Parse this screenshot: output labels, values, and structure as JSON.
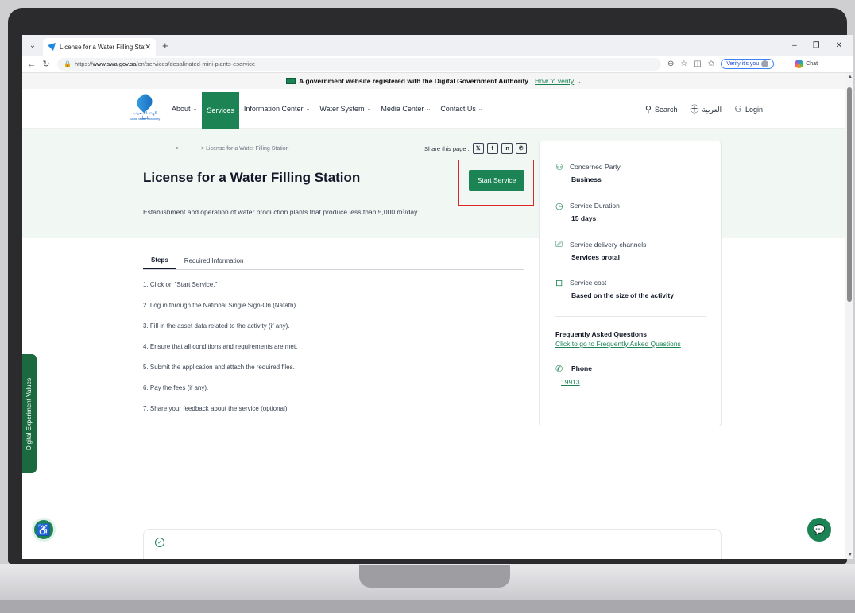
{
  "browser": {
    "tab_title": "License for a Water Filling Station",
    "url_prefix": "https://",
    "url_host": "www.swa.gov.sa",
    "url_path": "/en/services/desalinated-mini-plants-eservice",
    "verify_label": "Verify it's you",
    "chat_label": "Chat"
  },
  "govbar": {
    "text": "A government website registered with the Digital Government Authority",
    "how_to_verify": "How to verify"
  },
  "logo": {
    "arabic": "الهيئة السعودية للمياه",
    "english": "Saudi Water Authority"
  },
  "nav": {
    "about": "About",
    "services": "Services",
    "information_center": "Information Center",
    "water_system": "Water System",
    "media_center": "Media Center",
    "contact_us": "Contact Us",
    "search": "Search",
    "arabic": "العربية",
    "login": "Login"
  },
  "hero": {
    "breadcrumb_sep": ">",
    "breadcrumb_current": "> License for a Water Filling Station",
    "share_label": "Share this page :",
    "title": "License for a Water Filling Station",
    "start_button": "Start Service",
    "description": "Establishment and operation of water production plants that produce less than 5,000 m³/day."
  },
  "tabs": {
    "steps": "Steps",
    "required_info": "Required Information"
  },
  "steps": [
    "1. Click on \"Start Service.\"",
    "2. Log in through the National Single Sign-On (Nafath).",
    "3. Fill in the asset data related to the activity (if any).",
    "4. Ensure that all conditions and requirements are met.",
    "5. Submit the application and attach the required files.",
    "6. Pay the fees (if any).",
    "7. Share your feedback about the service (optional)."
  ],
  "card": {
    "party_label": "Concerned Party",
    "party_value": "Business",
    "duration_label": "Service Duration",
    "duration_value": "15 days",
    "channels_label": "Service delivery channels",
    "channels_value": "Services protal",
    "cost_label": "Service cost",
    "cost_value": "Based on the size of the activity",
    "faq_title": "Frequently Asked Questions",
    "faq_link": "Click to go to Frequently Asked Questions",
    "phone_label": "Phone",
    "phone_value": "19913"
  },
  "side_tab": "Digital Experiment Values",
  "colors": {
    "brand_green": "#1b8354",
    "hero_bg": "#f1f8f4",
    "highlight_red": "#dc2626"
  }
}
